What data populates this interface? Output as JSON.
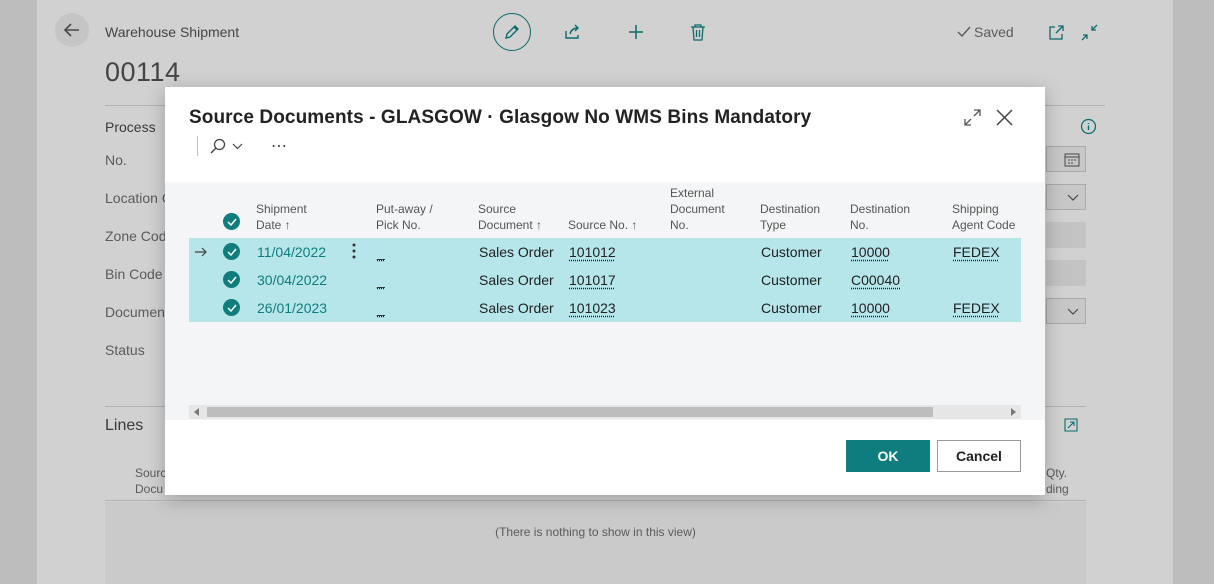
{
  "page": {
    "breadcrumb": "Warehouse Shipment",
    "doc_number": "00114",
    "saved_label": "Saved",
    "section_process": "Process",
    "fields": [
      "No.",
      "Location C",
      "Zone Cod",
      "Bin Code",
      "Documen",
      "Status"
    ],
    "lines_title": "Lines",
    "lines_col_left": [
      "Sourc",
      "Docu"
    ],
    "lines_col_right": [
      "Qty.",
      "ding"
    ],
    "empty_message": "(There is nothing to show in this view)"
  },
  "dialog": {
    "title": "Source Documents - GLASGOW · Glasgow No WMS Bins Mandatory",
    "more_actions": "⋯",
    "columns": {
      "shipment_date": [
        "Shipment",
        "Date ↑"
      ],
      "put_away": [
        "Put-away /",
        "Pick No."
      ],
      "source_document": [
        "Source",
        "Document ↑"
      ],
      "source_no": [
        "Source No. ↑"
      ],
      "external_doc": [
        "External",
        "Document",
        "No."
      ],
      "destination_type": [
        "Destination",
        "Type"
      ],
      "destination_no": [
        "Destination",
        "No."
      ],
      "shipping_agent": [
        "Shipping",
        "Agent Code"
      ]
    },
    "rows": [
      {
        "shipment_date": "11/04/2022",
        "put_away": "_",
        "source_document": "Sales Order",
        "source_no": "101012",
        "external_doc": "",
        "destination_type": "Customer",
        "destination_no": "10000",
        "shipping_agent": "FEDEX"
      },
      {
        "shipment_date": "30/04/2022",
        "put_away": "_",
        "source_document": "Sales Order",
        "source_no": "101017",
        "external_doc": "",
        "destination_type": "Customer",
        "destination_no": "C00040",
        "shipping_agent": ""
      },
      {
        "shipment_date": "26/01/2023",
        "put_away": "_",
        "source_document": "Sales Order",
        "source_no": "101023",
        "external_doc": "",
        "destination_type": "Customer",
        "destination_no": "10000",
        "shipping_agent": "FEDEX"
      }
    ],
    "ok_label": "OK",
    "cancel_label": "Cancel"
  },
  "colors": {
    "accent": "#0f7d7d",
    "row_selected": "#b6e6ea"
  },
  "icons": [
    "back-arrow-icon",
    "edit-icon",
    "share-icon",
    "plus-icon",
    "delete-icon",
    "check-icon",
    "open-new-window-icon",
    "collapse-icon",
    "info-icon",
    "expand-icon",
    "close-icon",
    "search-icon",
    "chevron-down-icon",
    "row-arrow-icon",
    "row-menu-icon"
  ]
}
